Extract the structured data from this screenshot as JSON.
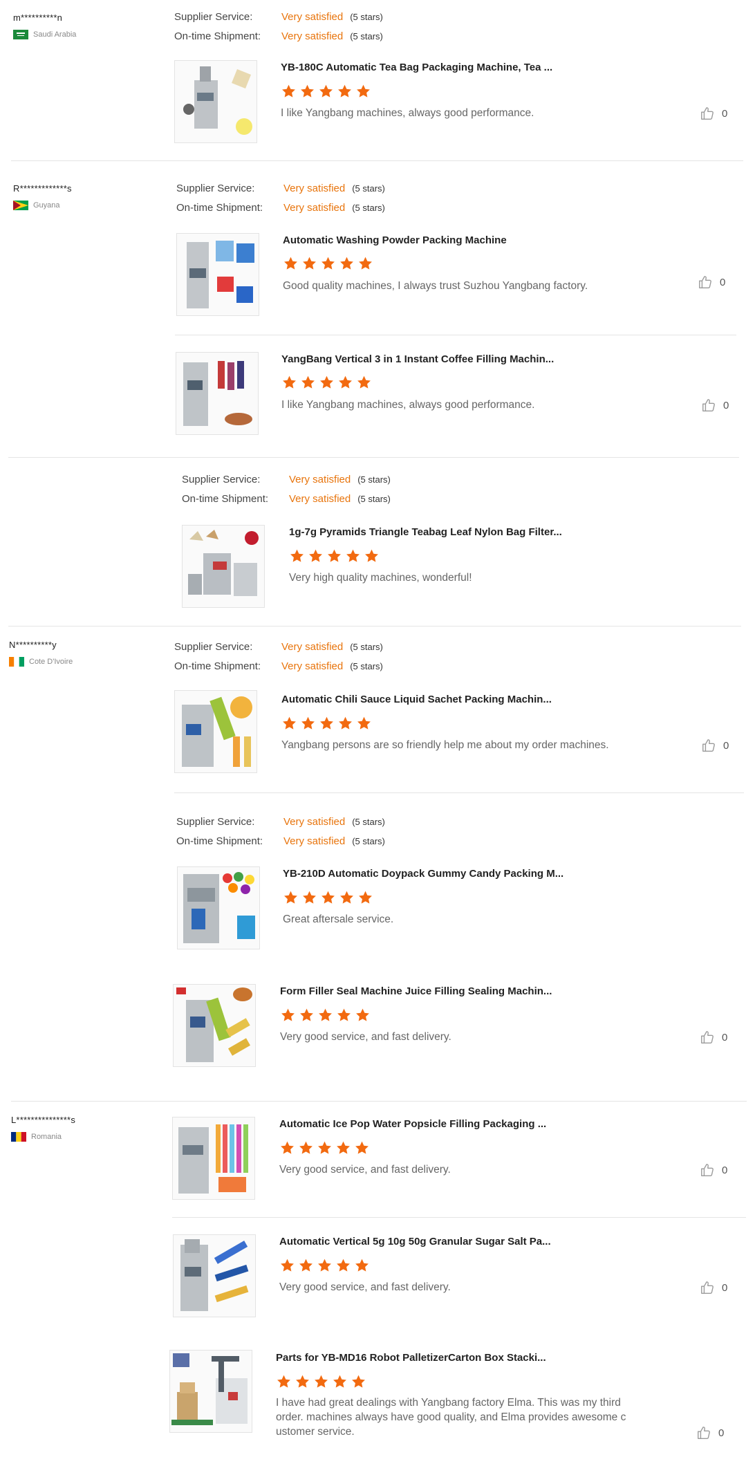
{
  "labels": {
    "supplier_service": "Supplier Service:",
    "on_time_shipment": "On-time Shipment:",
    "very_satisfied": "Very satisfied",
    "five_stars": "(5 stars)"
  },
  "colors": {
    "accent_orange": "#e8740c",
    "star": "#f26a10"
  },
  "buyers": [
    {
      "name": "m**********n",
      "country": "Saudi Arabia",
      "flag": "saudi-arabia"
    },
    {
      "name": "R*************s",
      "country": "Guyana",
      "flag": "guyana"
    },
    {
      "name": "N**********y",
      "country": "Cote D'Ivoire",
      "flag": "cote-divoire"
    },
    {
      "name": "L***************s",
      "country": "Romania",
      "flag": "romania"
    }
  ],
  "reviews": [
    {
      "product": "YB-180C Automatic Tea Bag Packaging Machine, Tea ...",
      "comment": "I like Yangbang machines, always good performance.",
      "likes": "0",
      "stars": 5
    },
    {
      "product": "Automatic Washing Powder Packing Machine",
      "comment": "Good quality machines, I always trust Suzhou Yangbang factory.",
      "likes": "0",
      "stars": 5
    },
    {
      "product": "YangBang Vertical 3 in 1 Instant Coffee Filling Machin...",
      "comment": "I like Yangbang machines, always good performance.",
      "likes": "0",
      "stars": 5
    },
    {
      "product": "1g-7g Pyramids Triangle Teabag Leaf Nylon Bag Filter...",
      "comment": "Very high quality machines, wonderful!",
      "likes": "",
      "stars": 5
    },
    {
      "product": "Automatic Chili Sauce Liquid Sachet Packing Machin...",
      "comment": "Yangbang persons are so friendly help me about my order machines.",
      "likes": "0",
      "stars": 5
    },
    {
      "product": "YB-210D Automatic Doypack Gummy Candy Packing M...",
      "comment": "Great aftersale service.",
      "likes": "",
      "stars": 5
    },
    {
      "product": "Form Filler Seal Machine Juice Filling Sealing Machin...",
      "comment": "Very good service, and fast delivery.",
      "likes": "0",
      "stars": 5
    },
    {
      "product": "Automatic Ice Pop Water Popsicle Filling Packaging ...",
      "comment": "Very good service, and fast delivery.",
      "likes": "0",
      "stars": 5
    },
    {
      "product": "Automatic Vertical 5g 10g 50g Granular Sugar Salt Pa...",
      "comment": "Very good service, and fast delivery.",
      "likes": "0",
      "stars": 5
    },
    {
      "product": "Parts for YB-MD16 Robot PalletizerCarton Box Stacki...",
      "comment": "I have had great dealings with Yangbang factory Elma. This was my third order. machines always have good quality, and Elma provides awesome c ustomer service.",
      "likes": "0",
      "stars": 5
    }
  ]
}
